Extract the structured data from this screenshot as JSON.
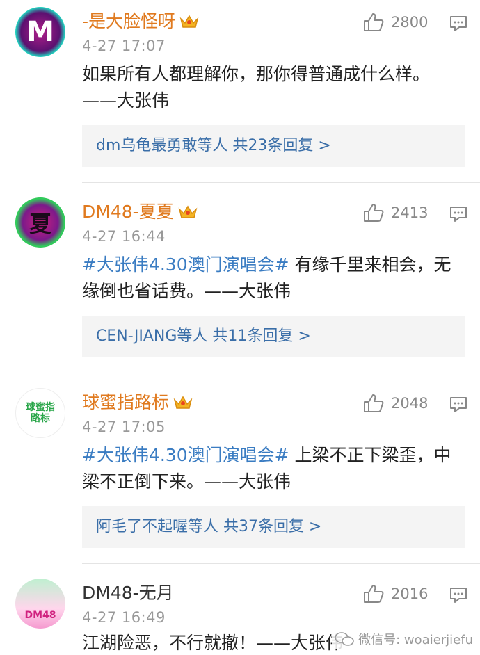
{
  "comments": [
    {
      "username": "-是大脸怪呀",
      "avatar_text": "M",
      "time": "4-27 17:07",
      "likes": "2800",
      "hashtag": "",
      "text": "如果所有人都理解你，那你得普通成什么样。——大张伟",
      "replies": "dm乌龟最勇敢等人  共23条回复 >"
    },
    {
      "username": "DM48-夏夏",
      "avatar_text": "夏",
      "time": "4-27 16:44",
      "likes": "2413",
      "hashtag": "#大张伟4.30澳门演唱会#",
      "text": " 有缘千里来相会，无缘倒也省话费。——大张伟",
      "replies": "CEN-JIANG等人  共11条回复 >"
    },
    {
      "username": "球蜜指路标",
      "avatar_text": "球蜜指路标",
      "time": "4-27 17:05",
      "likes": "2048",
      "hashtag": "#大张伟4.30澳门演唱会#",
      "text": " 上梁不正下梁歪，中梁不正倒下来。——大张伟",
      "replies": "阿毛了不起喔等人  共37条回复 >"
    },
    {
      "username": "DM48-无月",
      "avatar_text": "DM48",
      "time": "4-27 16:49",
      "likes": "2016",
      "hashtag": "",
      "text": "江湖险恶，不行就撤！——大张伟",
      "replies": ""
    }
  ],
  "watermark": {
    "text": "微信号: woaierjiefu"
  },
  "colors": {
    "username_vip": "#e07a1f",
    "hashtag": "#3a7cc2",
    "reply_link": "#3a6ea8",
    "meta": "#999999"
  },
  "icons": [
    "crown-icon",
    "thumbs-up-icon",
    "comment-reply-icon",
    "wechat-icon"
  ]
}
